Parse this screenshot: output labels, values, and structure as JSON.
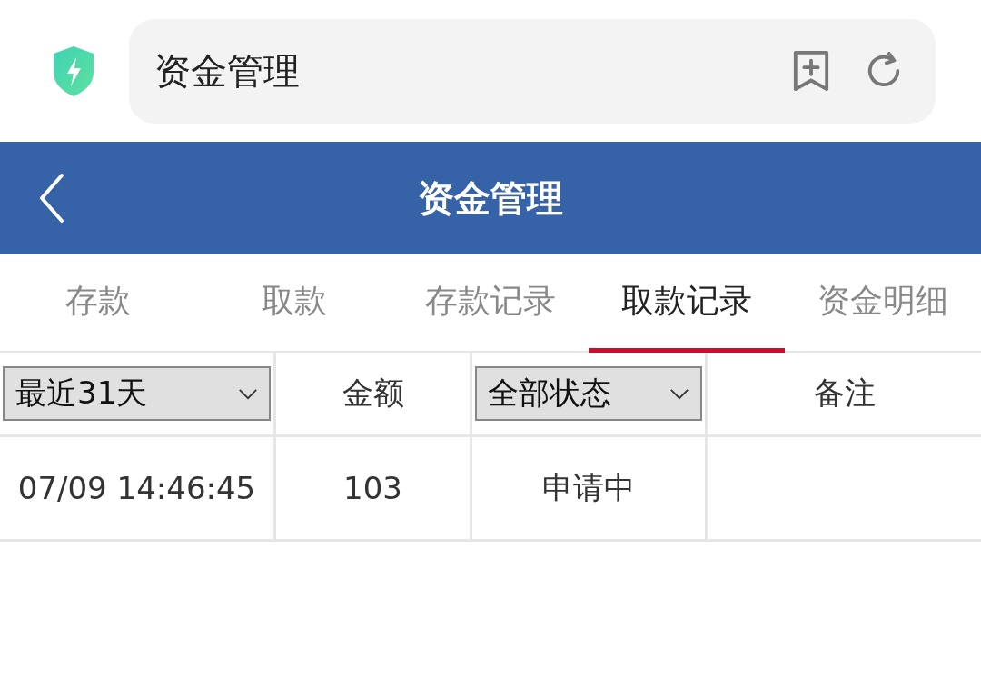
{
  "browser": {
    "address": "资金管理"
  },
  "header": {
    "title": "资金管理"
  },
  "tabs": [
    {
      "label": "存款",
      "selected": false
    },
    {
      "label": "取款",
      "selected": false
    },
    {
      "label": "存款记录",
      "selected": false
    },
    {
      "label": "取款记录",
      "selected": true
    },
    {
      "label": "资金明细",
      "selected": false
    }
  ],
  "table": {
    "columns": [
      {
        "kind": "select",
        "label": "最近31天"
      },
      {
        "kind": "text",
        "label": "金额"
      },
      {
        "kind": "select",
        "label": "全部状态"
      },
      {
        "kind": "text",
        "label": "备注"
      }
    ],
    "rows": [
      {
        "cells": [
          "07/09 14:46:45",
          "103",
          "申请中"
        ]
      }
    ]
  }
}
